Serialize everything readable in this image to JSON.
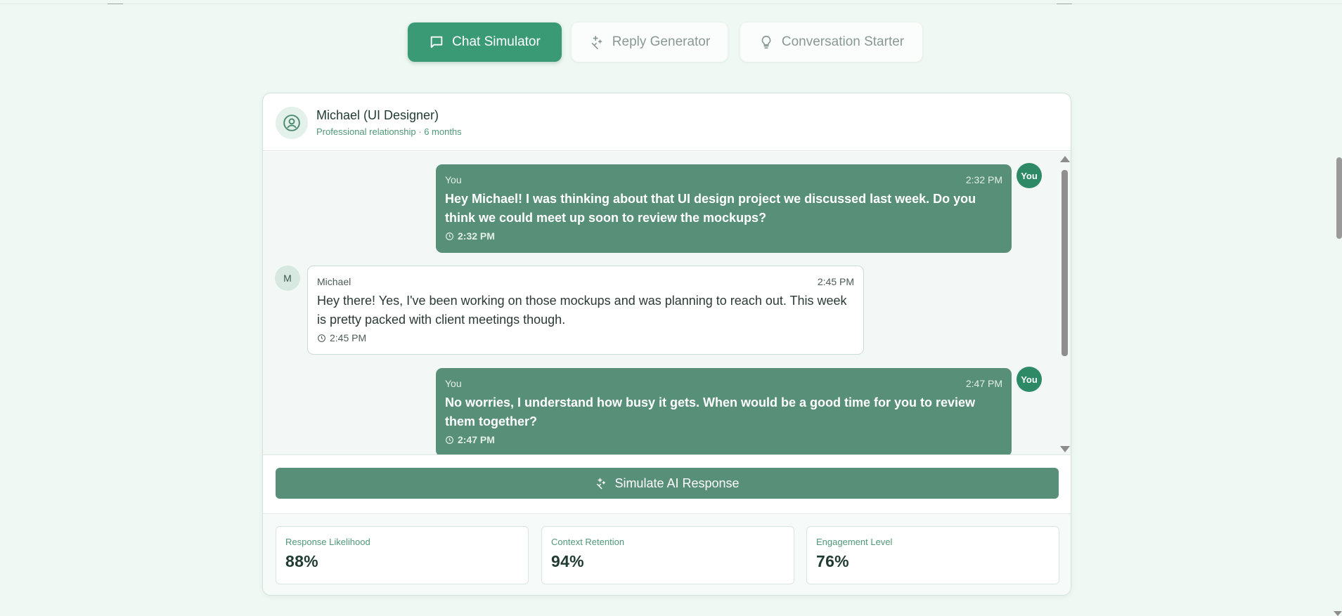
{
  "tabs": [
    {
      "label": "Chat Simulator",
      "icon": "message-square-icon",
      "active": true
    },
    {
      "label": "Reply Generator",
      "icon": "sparkles-icon",
      "active": false
    },
    {
      "label": "Conversation Starter",
      "icon": "lightbulb-icon",
      "active": false
    }
  ],
  "contact": {
    "name": "Michael (UI Designer)",
    "subtitle": "Professional relationship · 6 months",
    "avatar_icon": "user-circle-icon"
  },
  "messages": [
    {
      "direction": "outgoing",
      "sender": "You",
      "time": "2:32 PM",
      "text": "Hey Michael! I was thinking about that UI design project we discussed last week. Do you think we could meet up soon to review the mockups?",
      "stamp": "2:32 PM",
      "avatar": "You"
    },
    {
      "direction": "incoming",
      "sender": "Michael",
      "time": "2:45 PM",
      "text": "Hey there! Yes, I've been working on those mockups and was planning to reach out. This week is pretty packed with client meetings though.",
      "stamp": "2:45 PM",
      "avatar": "M"
    },
    {
      "direction": "outgoing",
      "sender": "You",
      "time": "2:47 PM",
      "text": "No worries, I understand how busy it gets. When would be a good time for you to review them together?",
      "stamp": "2:47 PM",
      "avatar": "You"
    }
  ],
  "action": {
    "label": "Simulate AI Response",
    "icon": "sparkles-icon"
  },
  "stats": [
    {
      "label": "Response Likelihood",
      "value": "88%"
    },
    {
      "label": "Context Retention",
      "value": "94%"
    },
    {
      "label": "Engagement Level",
      "value": "76%"
    }
  ],
  "colors": {
    "accent": "#3a9a76",
    "bubble_out": "#588f78",
    "background": "#f0f8f4"
  }
}
